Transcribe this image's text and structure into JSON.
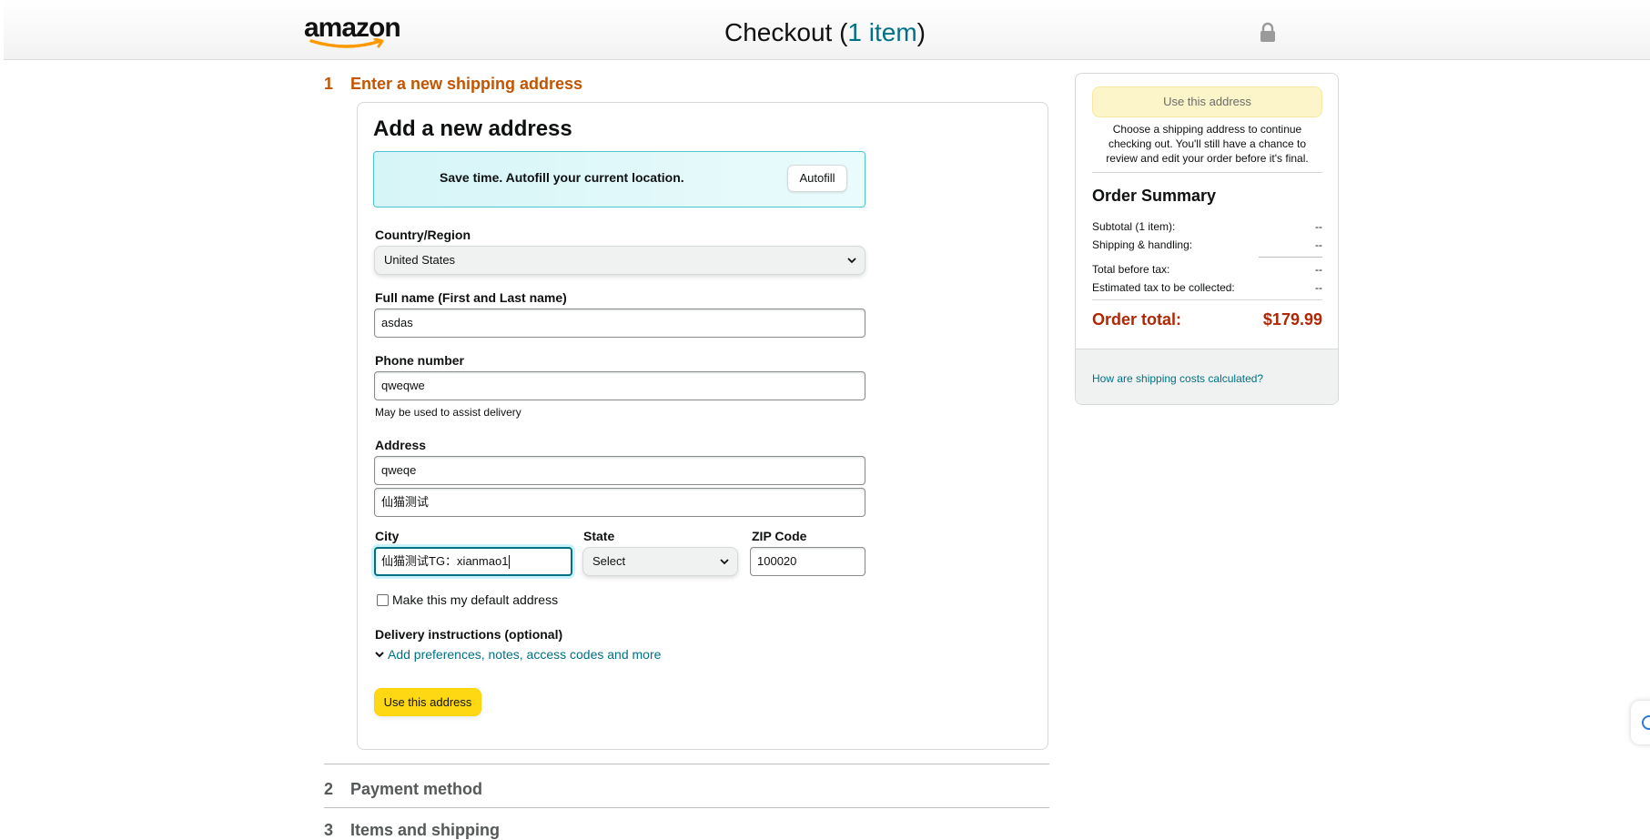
{
  "header": {
    "logo_text": "amazon",
    "checkout_title": "Checkout (",
    "item_count_text": "1 item",
    "checkout_close": ")",
    "lock_icon": "lock-icon"
  },
  "step1": {
    "number": "1",
    "title": "Enter a new shipping address"
  },
  "form": {
    "title": "Add a new address",
    "autofill": {
      "text": "Save time. Autofill your current location.",
      "button": "Autofill"
    },
    "country": {
      "label": "Country/Region",
      "value": "United States"
    },
    "full_name": {
      "label": "Full name (First and Last name)",
      "value": "asdas"
    },
    "phone": {
      "label": "Phone number",
      "value": "qweqwe",
      "helper": "May be used to assist delivery"
    },
    "address": {
      "label": "Address",
      "line1": "qweqe",
      "line2": "仙猫测试"
    },
    "city": {
      "label": "City",
      "value": "仙猫测试TG：xianmao1"
    },
    "state": {
      "label": "State",
      "value": "Select"
    },
    "zip": {
      "label": "ZIP Code",
      "value": "100020"
    },
    "default_checkbox": "Make this my default address",
    "delivery_instructions": {
      "label": "Delivery instructions (optional)",
      "link": "Add preferences, notes, access codes and more"
    },
    "submit": "Use this address"
  },
  "steps": {
    "step2": {
      "number": "2",
      "title": "Payment method"
    },
    "step3": {
      "number": "3",
      "title": "Items and shipping"
    }
  },
  "summary": {
    "button": "Use this address",
    "note": "Choose a shipping address to continue checking out. You'll still have a chance to review and edit your order before it's final.",
    "title": "Order Summary",
    "rows": [
      {
        "label": "Subtotal (1 item):",
        "value": "--"
      },
      {
        "label": "Shipping & handling:",
        "value": "--"
      },
      {
        "label": "Total before tax:",
        "value": "--"
      },
      {
        "label": "Estimated tax to be collected:",
        "value": "--"
      }
    ],
    "order_total_label": "Order total:",
    "order_total_value": "$179.99",
    "footer_link": "How are shipping costs calculated?"
  },
  "colors": {
    "accent_link": "#007185",
    "step_active": "#c45500",
    "price": "#b12704",
    "button_yellow": "#ffd814"
  }
}
